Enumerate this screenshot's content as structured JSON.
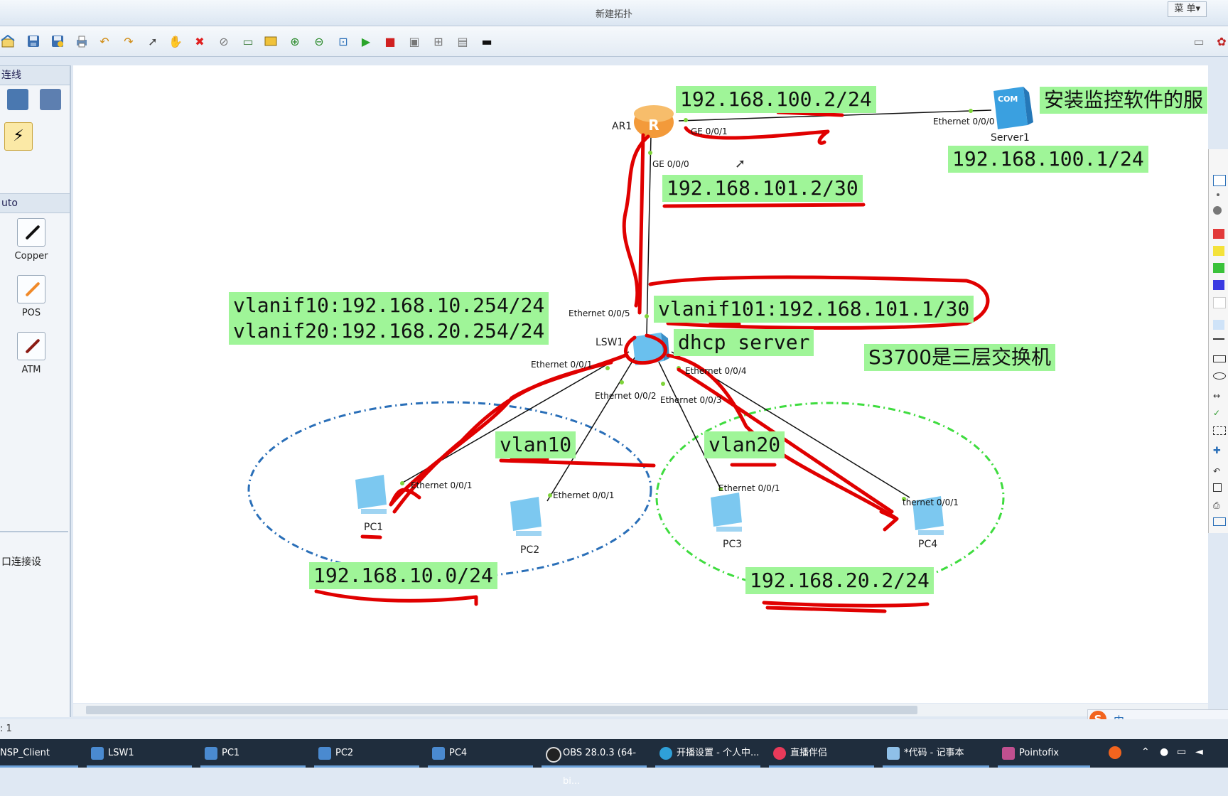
{
  "window": {
    "title": "新建拓扑",
    "menu_label": "菜 单▾"
  },
  "toolbar": {
    "icons": [
      "home-icon",
      "save-icon",
      "save-as-icon",
      "print-icon",
      "undo-icon",
      "redo-icon",
      "select-icon",
      "hand-icon",
      "delete-icon",
      "delete-link-icon",
      "text-icon",
      "palette-icon",
      "zoom-in-icon",
      "zoom-out-icon",
      "fit-icon",
      "start-icon",
      "stop-icon",
      "capture-icon",
      "topo-icon",
      "grid-icon",
      "cli-icon"
    ]
  },
  "left_panel": {
    "section1": "连线",
    "section2": "uto",
    "cables": [
      {
        "label": "Copper",
        "color": "#111111"
      },
      {
        "label": "POS",
        "color": "#f08a2a"
      },
      {
        "label": "ATM",
        "color": "#8b1b14"
      }
    ],
    "bottom_text": "口连接设"
  },
  "topology": {
    "devices": {
      "ar1": "AR1",
      "server1": "Server1",
      "lsw1": "LSW1",
      "pc1": "PC1",
      "pc2": "PC2",
      "pc3": "PC3",
      "pc4": "PC4",
      "server_badge": "COM"
    },
    "ports": {
      "ar1_ge001": "GE 0/0/1",
      "ar1_ge000": "GE 0/0/0",
      "server_eth": "Ethernet 0/0/0",
      "lsw_eth5": "Ethernet 0/0/5",
      "lsw_eth1": "Ethernet 0/0/1",
      "lsw_eth2": "Ethernet 0/0/2",
      "lsw_eth3": "Ethernet 0/0/3",
      "lsw_eth4": "Ethernet 0/0/4",
      "pc1_eth": "Ethernet 0/0/1",
      "pc2_eth": "Ethernet 0/0/1",
      "pc3_eth": "Ethernet 0/0/1",
      "pc4_eth": "thernet 0/0/1"
    },
    "labels": {
      "ar1_ge1_ip": "192.168.100.2/24",
      "server_ip": "192.168.100.1/24",
      "server_note": "安装监控软件的服",
      "ar1_ge0_ip": "192.168.101.2/30",
      "vlanif10": "vlanif10:192.168.10.254/24",
      "vlanif20": "vlanif20:192.168.20.254/24",
      "vlanif101": "vlanif101:192.168.101.1/30",
      "dhcp": "dhcp server",
      "s3700": "S3700是三层交换机",
      "vlan10": "vlan10",
      "vlan20": "vlan20",
      "net10": "192.168.10.0/24",
      "net20": "192.168.20.2/24"
    },
    "colors": {
      "vlan10_ring": "#2a6fb8",
      "vlan20_ring": "#3fdc3f",
      "annotation": "#e00000",
      "label_bg": "#9ff598"
    }
  },
  "status_bar": {
    "text": ": 1"
  },
  "taskbar": {
    "items": [
      "NSP_Client",
      "LSW1",
      "PC1",
      "PC2",
      "PC4",
      "OBS 28.0.3 (64-bi...",
      "开播设置 - 个人中...",
      "直播伴侣",
      "*代码 - 记事本",
      "Pointofix"
    ]
  },
  "tray": {
    "ime": "中"
  }
}
